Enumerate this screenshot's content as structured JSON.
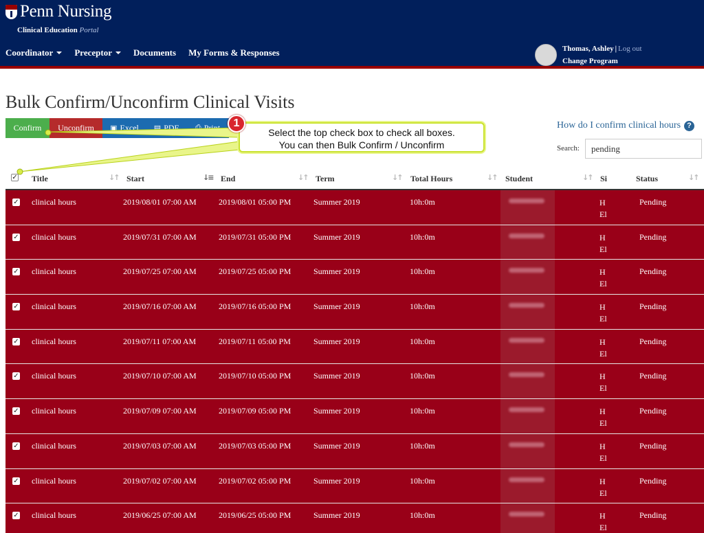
{
  "header": {
    "brand": "Penn Nursing",
    "subtitle_bold": "Clinical Education",
    "subtitle_italic": "Portal",
    "nav": [
      {
        "label": "Coordinator",
        "dropdown": true
      },
      {
        "label": "Preceptor",
        "dropdown": true
      },
      {
        "label": "Documents",
        "dropdown": false
      },
      {
        "label": "My Forms & Responses",
        "dropdown": false
      }
    ],
    "user": {
      "name": "Thomas, Ashley",
      "separator": "|",
      "logout": "Log out",
      "change_program": "Change Program"
    },
    "colors": {
      "navy": "#011f5b",
      "red": "#990000"
    }
  },
  "page": {
    "title": "Bulk Confirm/Unconfirm Clinical Visits",
    "buttons": {
      "confirm": "Confirm",
      "unconfirm": "Unconfirm",
      "excel": "Excel",
      "pdf": "PDF",
      "print": "Print"
    },
    "help_link": "How do I confirm clinical hours",
    "search_label": "Search:",
    "search_value": "pending"
  },
  "callout": {
    "number": "1",
    "line1": "Select the top check box to check all boxes.",
    "line2": "You can then Bulk Confirm / Unconfirm"
  },
  "table": {
    "columns": [
      "Title",
      "Start",
      "End",
      "Term",
      "Total Hours",
      "Student",
      "Si",
      "Status"
    ],
    "rows": [
      {
        "title": "clinical hours",
        "start": "2019/08/01 07:00 AM",
        "end": "2019/08/01 05:00 PM",
        "term": "Summer 2019",
        "hours": "10h:0m",
        "site1": "H",
        "site2": "El",
        "status": "Pending"
      },
      {
        "title": "clinical hours",
        "start": "2019/07/31 07:00 AM",
        "end": "2019/07/31 05:00 PM",
        "term": "Summer 2019",
        "hours": "10h:0m",
        "site1": "H",
        "site2": "El",
        "status": "Pending"
      },
      {
        "title": "clinical hours",
        "start": "2019/07/25 07:00 AM",
        "end": "2019/07/25 05:00 PM",
        "term": "Summer 2019",
        "hours": "10h:0m",
        "site1": "H",
        "site2": "El",
        "status": "Pending"
      },
      {
        "title": "clinical hours",
        "start": "2019/07/16 07:00 AM",
        "end": "2019/07/16 05:00 PM",
        "term": "Summer 2019",
        "hours": "10h:0m",
        "site1": "H",
        "site2": "El",
        "status": "Pending"
      },
      {
        "title": "clinical hours",
        "start": "2019/07/11 07:00 AM",
        "end": "2019/07/11 05:00 PM",
        "term": "Summer 2019",
        "hours": "10h:0m",
        "site1": "H",
        "site2": "El",
        "status": "Pending"
      },
      {
        "title": "clinical hours",
        "start": "2019/07/10 07:00 AM",
        "end": "2019/07/10 05:00 PM",
        "term": "Summer 2019",
        "hours": "10h:0m",
        "site1": "H",
        "site2": "El",
        "status": "Pending"
      },
      {
        "title": "clinical hours",
        "start": "2019/07/09 07:00 AM",
        "end": "2019/07/09 05:00 PM",
        "term": "Summer 2019",
        "hours": "10h:0m",
        "site1": "H",
        "site2": "El",
        "status": "Pending"
      },
      {
        "title": "clinical hours",
        "start": "2019/07/03 07:00 AM",
        "end": "2019/07/03 05:00 PM",
        "term": "Summer 2019",
        "hours": "10h:0m",
        "site1": "H",
        "site2": "El",
        "status": "Pending"
      },
      {
        "title": "clinical hours",
        "start": "2019/07/02 07:00 AM",
        "end": "2019/07/02 05:00 PM",
        "term": "Summer 2019",
        "hours": "10h:0m",
        "site1": "H",
        "site2": "El",
        "status": "Pending"
      },
      {
        "title": "clinical hours",
        "start": "2019/06/25 07:00 AM",
        "end": "2019/06/25 05:00 PM",
        "term": "Summer 2019",
        "hours": "10h:0m",
        "site1": "H",
        "site2": "El",
        "status": "Pending"
      }
    ],
    "row_color": "#990018"
  }
}
